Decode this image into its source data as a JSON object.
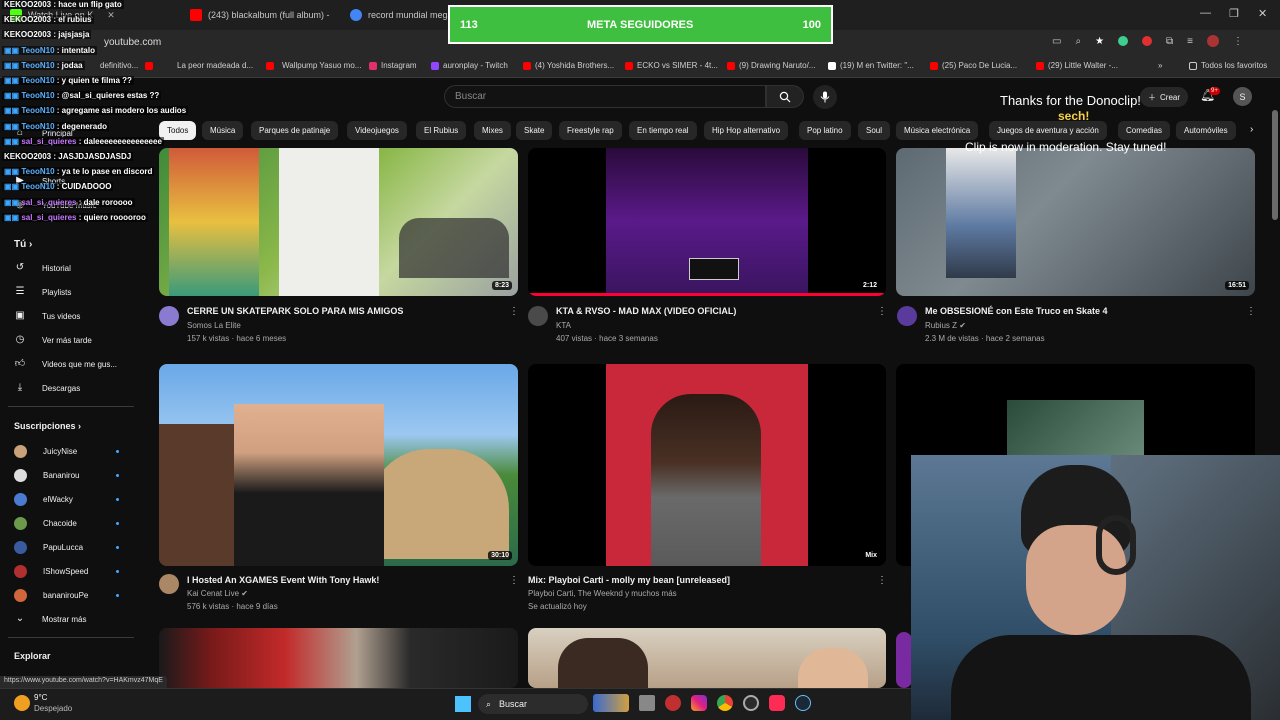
{
  "browser": {
    "tabs": [
      {
        "title": "Watch Live on K",
        "color": "#53fc18",
        "prefix": "eKO Stream"
      },
      {
        "title": "(243) blackalbum (full album) -",
        "color": "#ff0000"
      },
      {
        "title": "record mundial megab",
        "color": "#4285f4"
      }
    ],
    "address": "youtube.com",
    "bookmarks": [
      "definitivo...",
      "La peor madeada d...",
      "Wallpump Yasuo mo...",
      "Instagram",
      "auronplay - Twitch",
      "(4) Yoshida Brothers...",
      "ECKO vs SIMER - 4t...",
      "(9) Drawing Naruto/...",
      "(19) M en Twitter: \"...",
      "(25) Paco De Lucia...",
      "(29) Little Walter -...",
      "Todos los favoritos"
    ]
  },
  "youtube": {
    "search_placeholder": "Buscar",
    "create_label": "Crear",
    "bell_badge": "9+",
    "profile_initial": "S",
    "chips": [
      "Todos",
      "Música",
      "Parques de patinaje",
      "Videojuegos",
      "El Rubius",
      "Mixes",
      "Skate",
      "Freestyle rap",
      "En tiempo real",
      "Hip Hop alternativo",
      "Pop latino",
      "Soul",
      "Música electrónica",
      "Juegos de aventura y acción",
      "Comedias",
      "Automóviles"
    ],
    "sidebar": {
      "top_items": [
        "Principal",
        "Shorts",
        "YouTube Music"
      ],
      "you_heading": "Tú",
      "you_items": [
        "Historial",
        "Playlists",
        "Tus videos",
        "Ver más tarde",
        "Videos que me gus...",
        "Descargas"
      ],
      "subs_heading": "Suscripciones",
      "subs": [
        {
          "name": "JuicyNise",
          "color": "#c9a27a"
        },
        {
          "name": "Bananirou",
          "color": "#ddd"
        },
        {
          "name": "elWacky",
          "color": "#4a7bd0"
        },
        {
          "name": "Chacoide",
          "color": "#6a9a4a"
        },
        {
          "name": "PapuLucca",
          "color": "#3a5aa0"
        },
        {
          "name": "IShowSpeed",
          "color": "#b03030"
        },
        {
          "name": "bananirouPe",
          "color": "#d0663a"
        }
      ],
      "show_more": "Mostrar más",
      "explore_heading": "Explorar"
    },
    "videos": [
      {
        "title": "CERRE UN SKATEPARK SOLO PARA MIS AMIGOS",
        "channel": "Somos La Elite",
        "meta": "157 k vistas · hace 6 meses",
        "duration": "8:23",
        "verified": false
      },
      {
        "title": "KTA & RVSO - MAD MAX (VIDEO OFICIAL)",
        "channel": "KTA",
        "meta": "407 vistas · hace 3 semanas",
        "duration": "2:12",
        "verified": false
      },
      {
        "title": "Me OBSESIONÉ con Este Truco en Skate 4",
        "channel": "Rubius Z",
        "meta": "2.3 M de vistas · hace 2 semanas",
        "duration": "16:51",
        "verified": true
      },
      {
        "title": "I Hosted An XGAMES Event With Tony Hawk!",
        "channel": "Kai Cenat Live",
        "meta": "576 k vistas · hace 9 días",
        "duration": "30:10",
        "verified": true
      },
      {
        "title": "Mix: Playboi Carti - molly my bean [unreleased]",
        "channel": "Playboi Carti, The Weeknd y muchos más",
        "meta": "Se actualizó hoy",
        "duration": "Mix",
        "verified": false
      }
    ],
    "status_url": "https://www.youtube.com/watch?v=HAKmvz47MqE"
  },
  "stream_overlay": {
    "goal": {
      "left": "113",
      "label": "META SEGUIDORES",
      "right": "100"
    },
    "donation": {
      "line1": "Thanks for the Donoclip!",
      "name": "sech!",
      "line2": "Clip is now in moderation. Stay tuned!"
    },
    "chat": [
      {
        "user": "KEKOO2003",
        "msg": "hace un flip gato",
        "color": "#ffffff",
        "icons": false
      },
      {
        "user": "KEKOO2003",
        "msg": "el rubius",
        "color": "#ffffff",
        "icons": false
      },
      {
        "user": "KEKOO2003",
        "msg": "jajsjasja",
        "color": "#ffffff",
        "icons": false
      },
      {
        "user": "TeooN10",
        "msg": "intentalo",
        "color": "#5ab0ff",
        "icons": true
      },
      {
        "user": "TeooN10",
        "msg": "jodaa",
        "color": "#5ab0ff",
        "icons": true
      },
      {
        "user": "TeooN10",
        "msg": "y quien te filma ??",
        "color": "#5ab0ff",
        "icons": true
      },
      {
        "user": "TeooN10",
        "msg": "@sal_si_quieres estas ??",
        "color": "#5ab0ff",
        "icons": true
      },
      {
        "user": "TeooN10",
        "msg": "agregame asi modero los audios",
        "color": "#5ab0ff",
        "icons": true
      },
      {
        "user": "TeooN10",
        "msg": "degenerado",
        "color": "#5ab0ff",
        "icons": true
      },
      {
        "user": "sal_si_quieres",
        "msg": "daleeeeeeeeeeeeeee",
        "color": "#c678ff",
        "icons": true
      },
      {
        "user": "KEKOO2003",
        "msg": "JASJDJASDJASDJ",
        "color": "#ffffff",
        "icons": false
      },
      {
        "user": "TeooN10",
        "msg": "ya te lo pase en discord",
        "color": "#5ab0ff",
        "icons": true
      },
      {
        "user": "TeooN10",
        "msg": "CUIDADOOO",
        "color": "#5ab0ff",
        "icons": true
      },
      {
        "user": "sal_si_quieres",
        "msg": "dale roroooo",
        "color": "#c678ff",
        "icons": true
      },
      {
        "user": "sal_si_quieres",
        "msg": "quiero rooooroo",
        "color": "#c678ff",
        "icons": true
      }
    ]
  },
  "taskbar": {
    "weather_temp": "9°C",
    "weather_desc": "Despejado",
    "search_label": "Buscar"
  }
}
